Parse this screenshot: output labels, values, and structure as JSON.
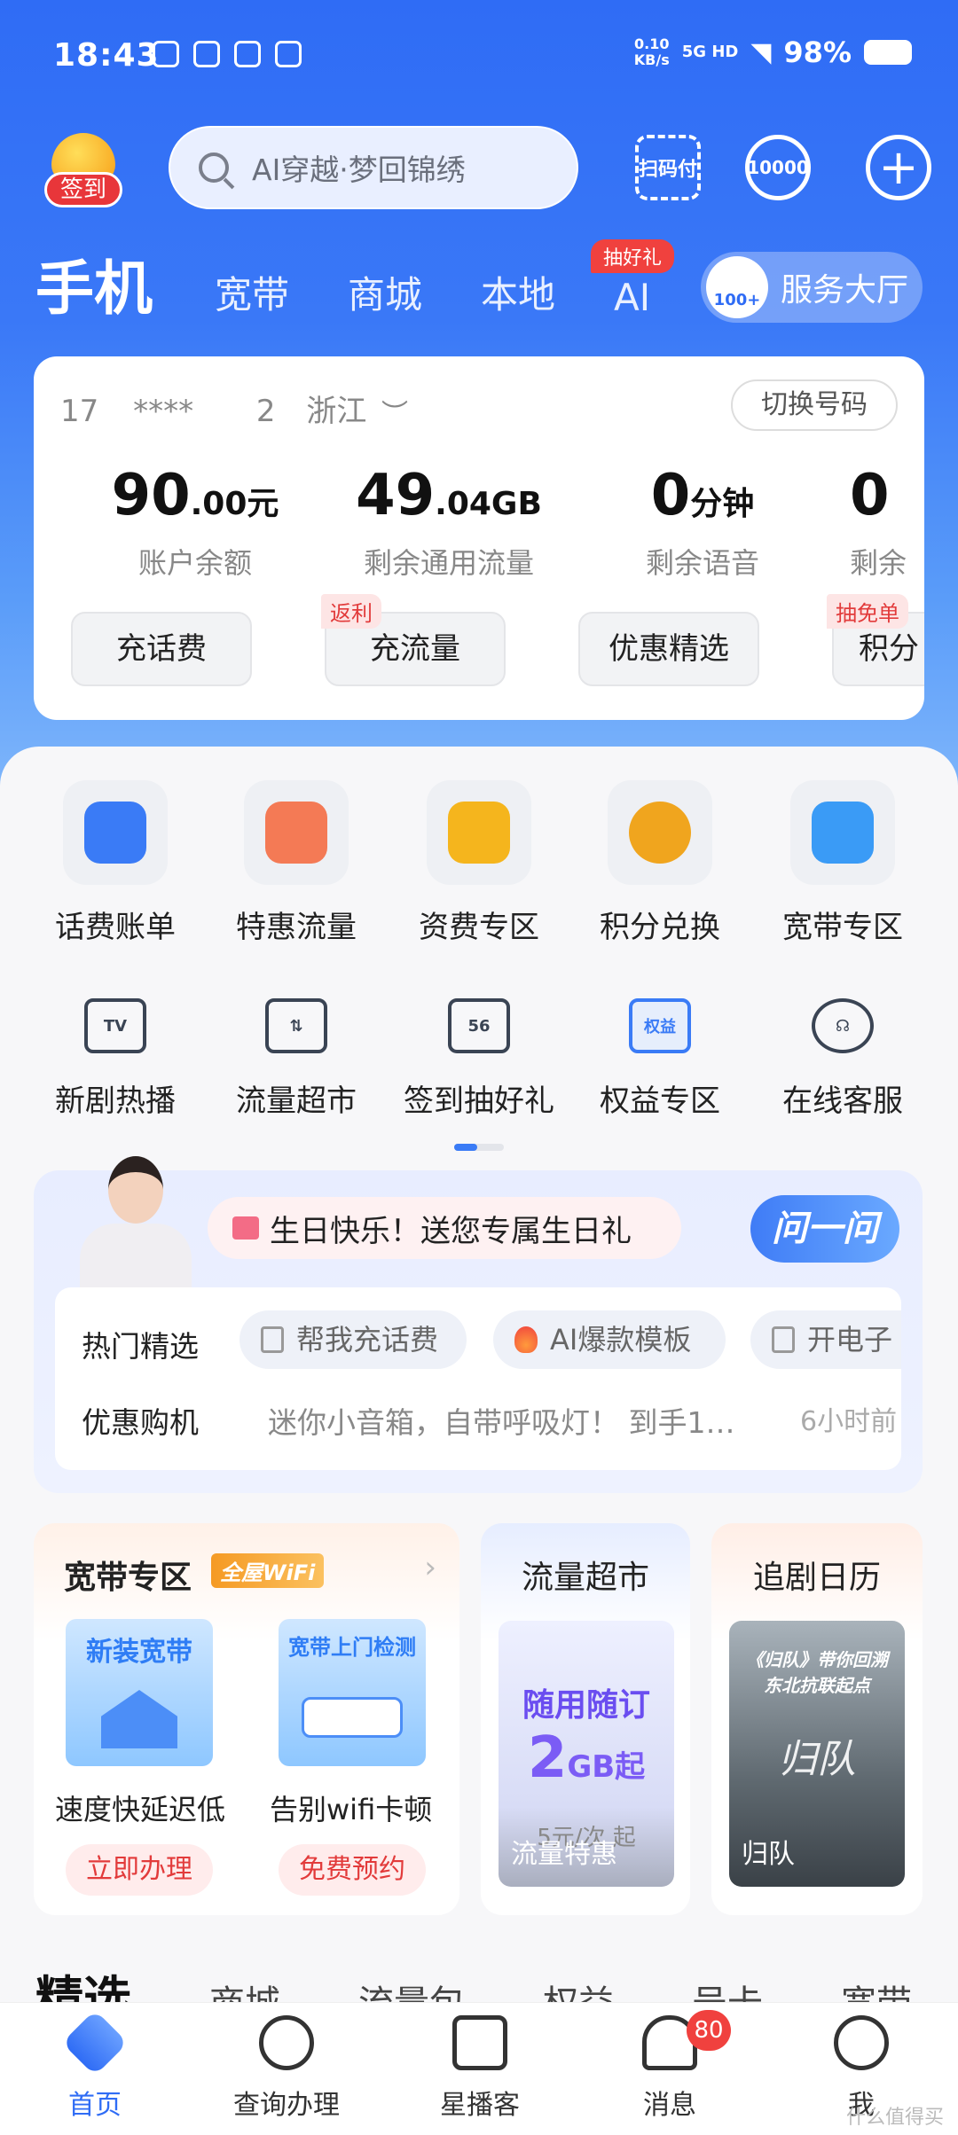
{
  "status": {
    "time": "18:43",
    "netspeed": "0.10\nKB/s",
    "signal": "5G HD",
    "battery": "98%"
  },
  "header": {
    "signin": "签到",
    "search_placeholder": "AI穿越·梦回锦绣",
    "scan_pay": "扫码付",
    "hotline": "10000"
  },
  "tabs": {
    "items": [
      "手机",
      "宽带",
      "商城",
      "本地",
      "AI"
    ],
    "ai_badge": "抽好礼",
    "service_hall": "服务大厅",
    "service_badge": "100+"
  },
  "account": {
    "number_prefix": "17",
    "number_mask": "****",
    "number_suffix": "2",
    "region": "浙江",
    "switch": "切换号码",
    "stats": [
      {
        "value": "90",
        "decimal": ".00",
        "unit": "元",
        "label": "账户余额",
        "button": "充话费"
      },
      {
        "value": "49",
        "decimal": ".04",
        "unit": "GB",
        "label": "剩余通用流量",
        "button": "充流量",
        "ribbon": "返利"
      },
      {
        "value": "0",
        "decimal": "",
        "unit": "分钟",
        "label": "剩余语音",
        "button": "优惠精选"
      },
      {
        "value": "0",
        "decimal": "",
        "unit": "",
        "label": "剩余",
        "button": "积分",
        "ribbon": "抽免单"
      }
    ]
  },
  "grid1": [
    "话费账单",
    "特惠流量",
    "资费专区",
    "积分兑换",
    "宽带专区"
  ],
  "grid1_colors": [
    "#3a7bf6",
    "#f47a55",
    "#f5b51d",
    "#f0a51e",
    "#3a9bf6"
  ],
  "grid2": [
    {
      "label": "新剧热播",
      "glyph": "TV"
    },
    {
      "label": "流量超市",
      "glyph": "⇅"
    },
    {
      "label": "签到抽好礼",
      "glyph": "56"
    },
    {
      "label": "权益专区",
      "glyph": "权益"
    },
    {
      "label": "在线客服",
      "glyph": "☊"
    }
  ],
  "ai": {
    "birthday": "生日快乐！送您专属生日礼",
    "ask": "问一问",
    "hot_label": "热门精选",
    "chips": [
      "帮我充话费",
      "AI爆款模板",
      "开电子"
    ],
    "deal_label": "优惠购机",
    "deal_text": "迷你小音箱，自带呼吸灯！ 到手1…",
    "deal_time": "6小时前"
  },
  "broadband": {
    "title": "宽带专区",
    "tag": "全屋WiFi",
    "tiles": [
      {
        "title": "新装宽带",
        "sub": "速度快延迟低",
        "btn": "立即办理"
      },
      {
        "title": "宽带上门检测",
        "sub": "告别wifi卡顿",
        "btn": "免费预约"
      }
    ]
  },
  "flow": {
    "title": "流量超市",
    "line1": "随用随订",
    "big": "2",
    "big_unit": "GB起",
    "price": "5元/次 起",
    "caption": "流量特惠"
  },
  "drama": {
    "title": "追剧日历",
    "poster_text": "《归队》带你回溯东北抗联起点",
    "big": "归队",
    "caption": "归队"
  },
  "categories": [
    "精选",
    "商城",
    "流量包",
    "权益",
    "号卡",
    "宽带"
  ],
  "nav": [
    {
      "label": "首页"
    },
    {
      "label": "查询办理"
    },
    {
      "label": "星播客"
    },
    {
      "label": "消息",
      "badge": "80"
    },
    {
      "label": "我"
    }
  ],
  "watermark": "什么值得买"
}
